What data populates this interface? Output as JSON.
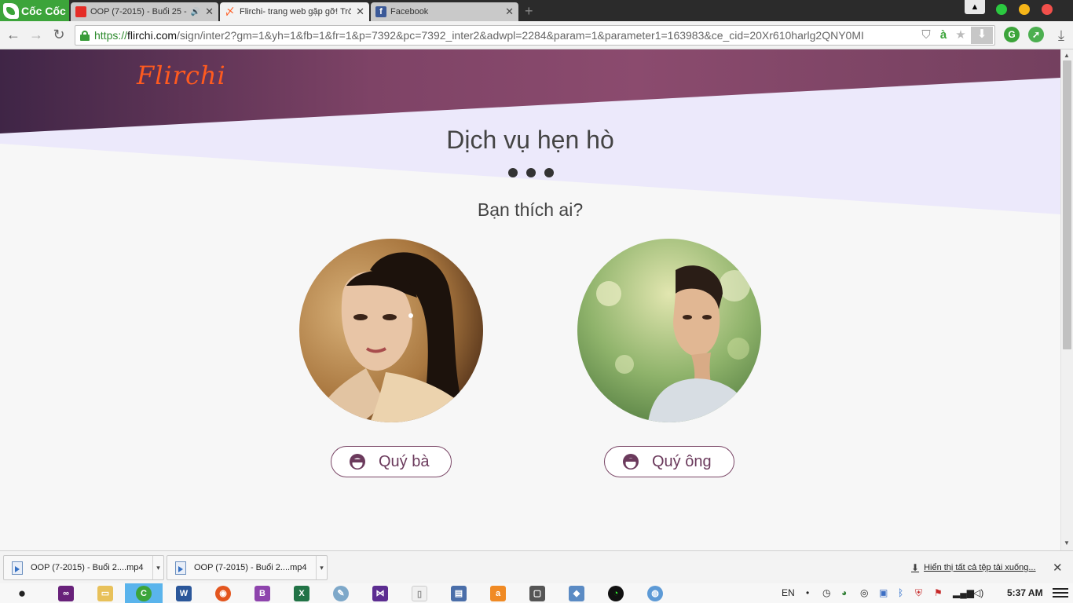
{
  "browser": {
    "logo_text": "Cốc Cốc",
    "tabs": [
      {
        "title": "OOP (7-2015) - Buổi 25 - ",
        "favicon": "youtube-icon",
        "color": "#e52d27",
        "audio": true
      },
      {
        "title": "Flirchi- trang web gặp gỡ! Trò",
        "favicon": "flirchi-icon",
        "color": "#ff5a1f",
        "active": true
      },
      {
        "title": "Facebook",
        "favicon": "facebook-icon",
        "color": "#3b5998"
      }
    ],
    "url": {
      "protocol": "https://",
      "host": "flirchi.com",
      "path": "/sign/inter2?gm=1&yh=1&fb=1&fr=1&p=7392&pc=7392_inter2&adwpl=2284&param=1&parameter1=163983&ce_cid=20Xr610harlg2QNY0MI"
    }
  },
  "page": {
    "brand": "Flirchi",
    "headline": "Dịch vụ hẹn hò",
    "question": "Bạn thích ai?",
    "choices": {
      "female": "Quý bà",
      "male": "Quý ông"
    },
    "colors": {
      "header_dark": "#4b2a50",
      "header_mid": "#8a4a6e",
      "header_light_band": "#eeebfb",
      "accent": "#ff5a1f",
      "button_border": "#7a4666"
    }
  },
  "downloads": {
    "items": [
      {
        "name": "OOP (7-2015) - Buổi 2....mp4"
      },
      {
        "name": "OOP (7-2015) - Buổi 2....mp4"
      }
    ],
    "show_all": "Hiển thị tất cả tệp tải xuống..."
  },
  "taskbar": {
    "language": "EN",
    "time": "5:37 AM"
  }
}
